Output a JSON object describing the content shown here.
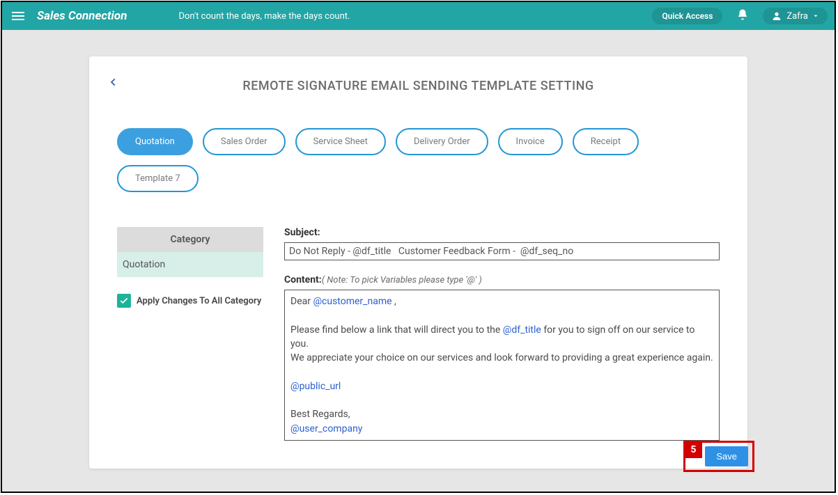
{
  "header": {
    "brand": "Sales Connection",
    "tagline": "Don't count the days, make the days count.",
    "quick_access": "Quick Access",
    "user_name": "Zafra"
  },
  "page": {
    "title": "REMOTE SIGNATURE EMAIL SENDING TEMPLATE SETTING",
    "tabs": [
      {
        "label": "Quotation",
        "active": true
      },
      {
        "label": "Sales Order",
        "active": false
      },
      {
        "label": "Service Sheet",
        "active": false
      },
      {
        "label": "Delivery Order",
        "active": false
      },
      {
        "label": "Invoice",
        "active": false
      },
      {
        "label": "Receipt",
        "active": false
      },
      {
        "label": "Template 7",
        "active": false
      }
    ],
    "category_header": "Category",
    "category_items": [
      "Quotation"
    ],
    "apply_all_label": "Apply Changes To All Category",
    "apply_all_checked": true,
    "subject_label": "Subject:",
    "subject_value": "Do Not Reply - @df_title   Customer Feedback Form -  @df_seq_no",
    "content_label": "Content:",
    "content_note": "( Note: To pick Variables please type '@' )",
    "content_body": {
      "line1_a": "Dear ",
      "line1_var": "@customer_name",
      "line1_b": " ,",
      "line2_a": "Please find below a link that will direct you to the ",
      "line2_var": "@df_title",
      "line2_b": " for you to sign off on our service to you.",
      "line3": "We appreciate your choice on our services and look forward to providing a great experience again.",
      "line4_var": "@public_url",
      "line5": "Best Regards,",
      "line6_var": "@user_company"
    },
    "save_label": "Save",
    "annotation_number": "5"
  }
}
